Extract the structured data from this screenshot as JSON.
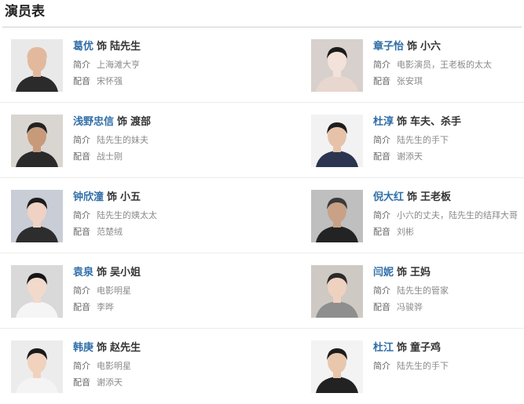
{
  "page": {
    "title": "演员表"
  },
  "labels": {
    "role_prefix": "饰",
    "intro_key": "简介",
    "dub_key": "配音"
  },
  "colors": {
    "actor_name": "#2f6ea7",
    "divider": "#cfcfcf",
    "text_muted": "#8a8a8a"
  },
  "cast": [
    {
      "actor": "葛优",
      "role": "陆先生",
      "intro": "上海滩大亨",
      "dub": "宋怀强",
      "photo": {
        "bg": "#e9e9e9",
        "skin": "#e2b99c",
        "hair": "#e2b99c",
        "cloth": "#2b2b2b"
      }
    },
    {
      "actor": "章子怡",
      "role": "小六",
      "intro": "电影演员，王老板的太太",
      "dub": "张安琪",
      "photo": {
        "bg": "#d8d0cd",
        "skin": "#f3e2d9",
        "hair": "#1b1b1b",
        "cloth": "#e8d7ce"
      }
    },
    {
      "actor": "浅野忠信",
      "role": "渡部",
      "intro": "陆先生的妹夫",
      "dub": "战士刚",
      "photo": {
        "bg": "#d9d6d2",
        "skin": "#c79a7a",
        "hair": "#222222",
        "cloth": "#2a2a2a"
      }
    },
    {
      "actor": "杜淳",
      "role": "车夫、杀手",
      "intro": "陆先生的手下",
      "dub": "谢添天",
      "photo": {
        "bg": "#f2f2f2",
        "skin": "#e6c3a8",
        "hair": "#1e1e1e",
        "cloth": "#2b3550"
      }
    },
    {
      "actor": "钟欣潼",
      "role": "小五",
      "intro": "陆先生的姨太太",
      "dub": "范楚绒",
      "photo": {
        "bg": "#c9cdd6",
        "skin": "#efd2c3",
        "hair": "#1c1c1c",
        "cloth": "#2d2d2d"
      }
    },
    {
      "actor": "倪大红",
      "role": "王老板",
      "intro": "小六的丈夫，陆先生的结拜大哥",
      "dub": "刘彬",
      "photo": {
        "bg": "#bfbfbf",
        "skin": "#c9a186",
        "hair": "#3a3a3a",
        "cloth": "#232323"
      }
    },
    {
      "actor": "袁泉",
      "role": "吴小姐",
      "intro": "电影明星",
      "dub": "李晔",
      "photo": {
        "bg": "#d9d9d9",
        "skin": "#f1d9cb",
        "hair": "#151515",
        "cloth": "#f5f5f5"
      }
    },
    {
      "actor": "闫妮",
      "role": "王妈",
      "intro": "陆先生的管家",
      "dub": "冯骏骅",
      "photo": {
        "bg": "#cfc9c4",
        "skin": "#eed1bf",
        "hair": "#2a2a2a",
        "cloth": "#8e8e8e"
      }
    },
    {
      "actor": "韩庚",
      "role": "赵先生",
      "intro": "电影明星",
      "dub": "谢添天",
      "photo": {
        "bg": "#ececec",
        "skin": "#f0d2bd",
        "hair": "#1a1a1a",
        "cloth": "#f4f4f4"
      }
    },
    {
      "actor": "杜江",
      "role": "童子鸡",
      "intro": "陆先生的手下",
      "photo": {
        "bg": "#f3f3f3",
        "skin": "#e8c7ad",
        "hair": "#1c1c1c",
        "cloth": "#222222"
      }
    }
  ]
}
